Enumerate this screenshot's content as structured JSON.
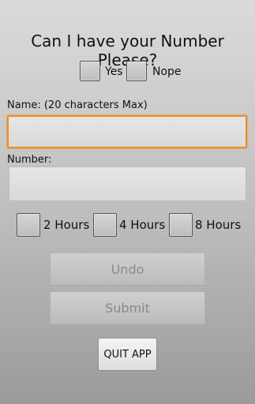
{
  "title": "Can I have your Number Please?",
  "consent": {
    "yes_label": "Yes",
    "nope_label": "Nope"
  },
  "name_field": {
    "label": "Name: (20 characters Max)",
    "value": ""
  },
  "number_field": {
    "label": "Number:",
    "value": ""
  },
  "hours": [
    {
      "label": "2 Hours"
    },
    {
      "label": "4 Hours"
    },
    {
      "label": "8 Hours"
    }
  ],
  "buttons": {
    "undo": "Undo",
    "submit": "Submit",
    "quit": "QUIT APP"
  },
  "colors": {
    "focus": "#f08a24"
  }
}
